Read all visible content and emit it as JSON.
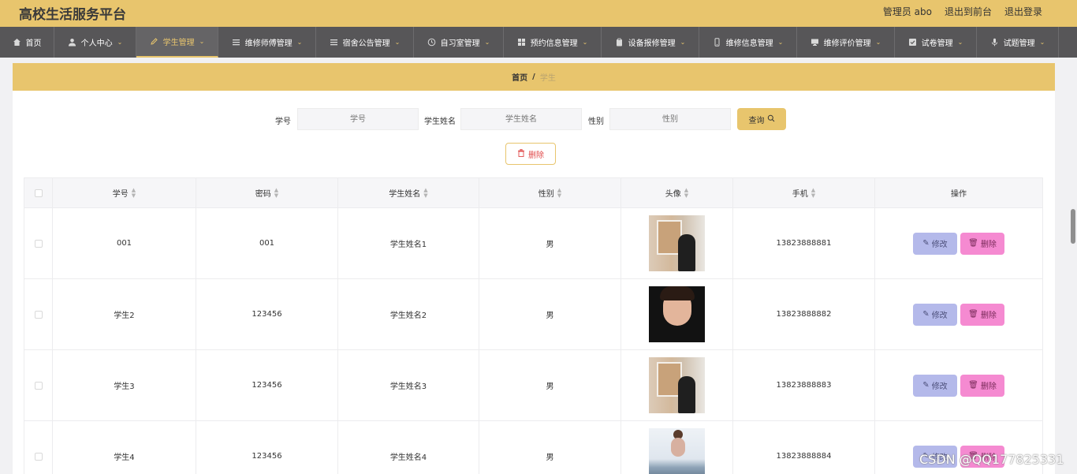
{
  "header": {
    "title": "高校生活服务平台",
    "admin_label": "管理员 abo",
    "to_front": "退出到前台",
    "logout": "退出登录"
  },
  "nav": [
    {
      "label": "首页",
      "icon": "home-icon",
      "chevron": false
    },
    {
      "label": "个人中心",
      "icon": "user-icon",
      "chevron": true
    },
    {
      "label": "学生管理",
      "icon": "pen-icon",
      "chevron": true,
      "active": true
    },
    {
      "label": "维修师傅管理",
      "icon": "list-icon",
      "chevron": true
    },
    {
      "label": "宿舍公告管理",
      "icon": "list-icon",
      "chevron": true
    },
    {
      "label": "自习室管理",
      "icon": "clock-icon",
      "chevron": true
    },
    {
      "label": "预约信息管理",
      "icon": "grid-icon",
      "chevron": true
    },
    {
      "label": "设备报修管理",
      "icon": "clipboard-icon",
      "chevron": true
    },
    {
      "label": "维修信息管理",
      "icon": "phone-icon",
      "chevron": true
    },
    {
      "label": "维修评价管理",
      "icon": "monitor-icon",
      "chevron": true
    },
    {
      "label": "试卷管理",
      "icon": "check-icon",
      "chevron": true
    },
    {
      "label": "试题管理",
      "icon": "mic-icon",
      "chevron": true
    }
  ],
  "breadcrumb": {
    "home": "首页",
    "sep": "/",
    "current": "学生"
  },
  "search": {
    "id_label": "学号",
    "id_placeholder": "学号",
    "name_label": "学生姓名",
    "name_placeholder": "学生姓名",
    "gender_label": "性别",
    "gender_placeholder": "性别",
    "query_button": "查询"
  },
  "delete_button": "删除",
  "table": {
    "headers": [
      "学号",
      "密码",
      "学生姓名",
      "性别",
      "头像",
      "手机",
      "操作"
    ],
    "edit_label": "修改",
    "delete_label": "删除",
    "rows": [
      {
        "id": "001",
        "password": "001",
        "name": "学生姓名1",
        "gender": "男",
        "phone": "13823888881"
      },
      {
        "id": "学生2",
        "password": "123456",
        "name": "学生姓名2",
        "gender": "男",
        "phone": "13823888882"
      },
      {
        "id": "学生3",
        "password": "123456",
        "name": "学生姓名3",
        "gender": "男",
        "phone": "13823888883"
      },
      {
        "id": "学生4",
        "password": "123456",
        "name": "学生姓名4",
        "gender": "男",
        "phone": "13823888884"
      }
    ]
  },
  "watermark": "CSDN @QQ177825331",
  "colors": {
    "accent": "#e8c56d",
    "nav_bg": "#575658",
    "edit_btn": "#b4b9ea",
    "delete_btn": "#f58ad1"
  }
}
